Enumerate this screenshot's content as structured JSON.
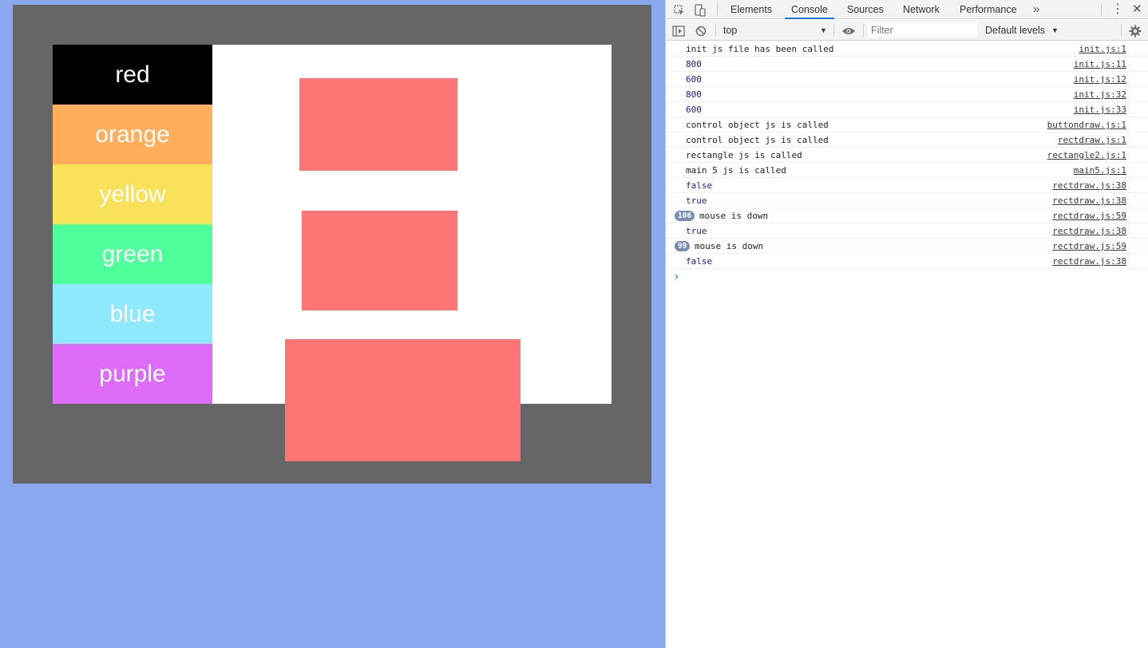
{
  "app": {
    "color_buttons": [
      {
        "label": "red",
        "color": "#000000"
      },
      {
        "label": "orange",
        "color": "#ffae5c"
      },
      {
        "label": "yellow",
        "color": "#f9e15a"
      },
      {
        "label": "green",
        "color": "#4fff9c"
      },
      {
        "label": "blue",
        "color": "#8fe9fd"
      },
      {
        "label": "purple",
        "color": "#df6cf9"
      }
    ],
    "rect_color": "#ff7474",
    "frame_color": "#666666",
    "page_background": "#8aa8ef"
  },
  "devtools": {
    "tabs": [
      {
        "label": "Elements"
      },
      {
        "label": "Console",
        "active": true
      },
      {
        "label": "Sources"
      },
      {
        "label": "Network"
      },
      {
        "label": "Performance"
      }
    ],
    "more_tabs_icon": "chevron-double-right-icon",
    "context_select": "top",
    "filter_placeholder": "Filter",
    "levels": "Default levels",
    "log": [
      {
        "msg": "init js file has been called",
        "src": "init.js:1",
        "kind": "text"
      },
      {
        "msg": "800",
        "src": "init.js:11",
        "kind": "num"
      },
      {
        "msg": "600",
        "src": "init.js:12",
        "kind": "num"
      },
      {
        "msg": "800",
        "src": "init.js:32",
        "kind": "num"
      },
      {
        "msg": "600",
        "src": "init.js:33",
        "kind": "num"
      },
      {
        "msg": "control object js is called",
        "src": "buttondraw.js:1",
        "kind": "text"
      },
      {
        "msg": "control object js is called",
        "src": "rectdraw.js:1",
        "kind": "text"
      },
      {
        "msg": "rectangle js is called",
        "src": "rectangle2.js:1",
        "kind": "text"
      },
      {
        "msg": "main 5 js is called",
        "src": "main5.js:1",
        "kind": "text"
      },
      {
        "msg": "false",
        "src": "rectdraw.js:38",
        "kind": "bool"
      },
      {
        "msg": "true",
        "src": "rectdraw.js:38",
        "kind": "bool"
      },
      {
        "msg": "mouse is down",
        "src": "rectdraw.js:59",
        "kind": "text",
        "count": "106"
      },
      {
        "msg": "true",
        "src": "rectdraw.js:38",
        "kind": "bool"
      },
      {
        "msg": "mouse is down",
        "src": "rectdraw.js:59",
        "kind": "text",
        "count": "99"
      },
      {
        "msg": "false",
        "src": "rectdraw.js:38",
        "kind": "bool"
      }
    ],
    "prompt_glyph": "›"
  }
}
